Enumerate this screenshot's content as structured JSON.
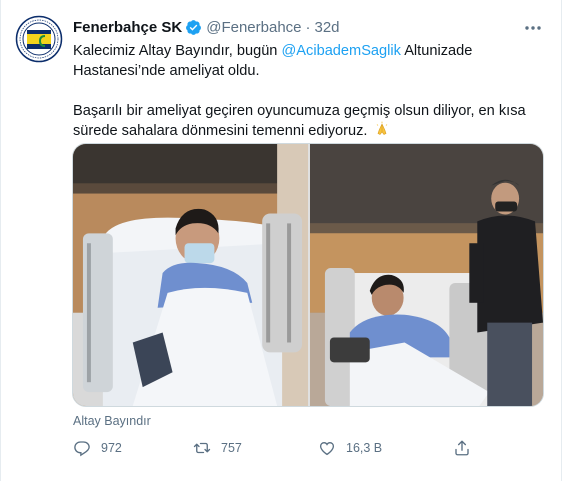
{
  "tweet": {
    "author_name": "Fenerbahçe SK",
    "handle": "@Fenerbahce",
    "separator": "·",
    "time": "32d",
    "text_part1": "Kalecimiz Altay Bayındır, bugün ",
    "mention": "@AcibademSaglik",
    "text_part2": " Altunizade Hastanesi’nde ameliyat oldu.",
    "text_para2": "Başarılı bir ameliyat geçiren oyuncumuza geçmiş olsun diliyor, en kısa sürede sahalara dönmesini temenni ediyoruz.",
    "emoji_icon": "folded-hands-emoji",
    "tagged_user": "Altay Bayındır",
    "avatar_icon": "fenerbahce-crest",
    "verified_icon": "verified-badge-icon",
    "accent_color": "#1da1f2",
    "stats": {
      "replies": "972",
      "retweets": "757",
      "likes": "16,3 B"
    },
    "icons": {
      "reply": "reply-icon",
      "retweet": "retweet-icon",
      "like": "heart-icon",
      "share": "share-icon",
      "more": "more-options-icon"
    }
  }
}
